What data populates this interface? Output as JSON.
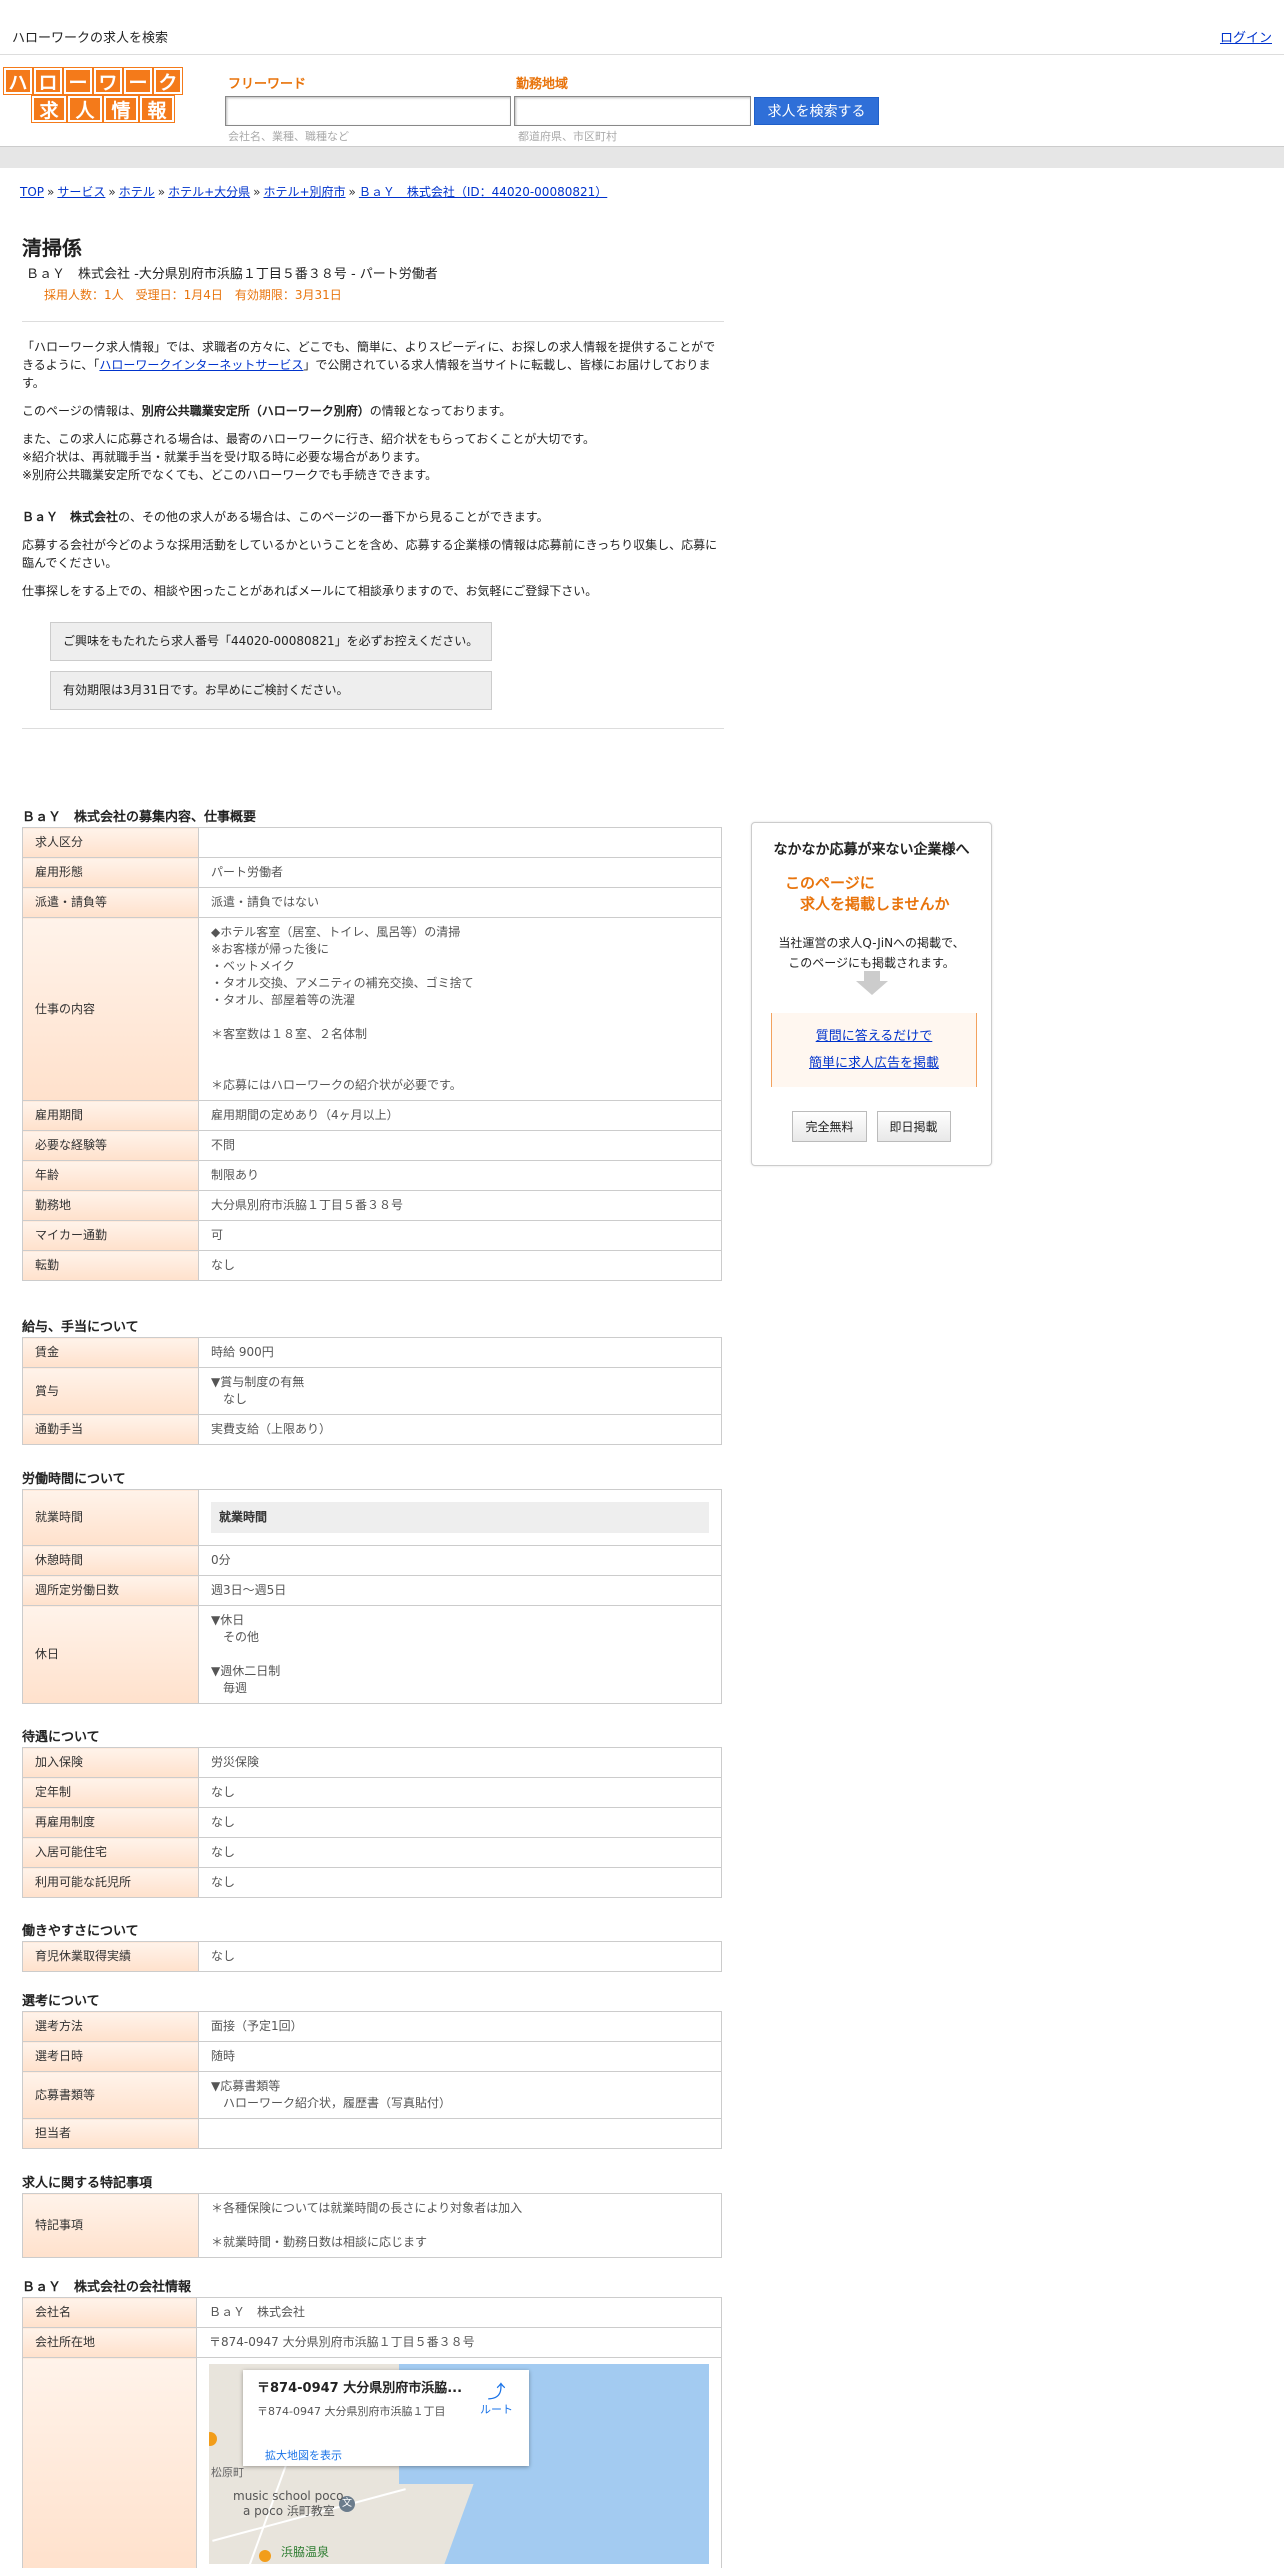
{
  "topbar": {
    "site_title": "ハローワークの求人を検索",
    "login": "ログイン"
  },
  "header": {
    "logo_row1": [
      "ハ",
      "ロ",
      "ー",
      "ワ",
      "ー",
      "ク"
    ],
    "logo_row2": [
      "求",
      "人",
      "情",
      "報"
    ],
    "freeword_label": "フリーワード",
    "freeword_hint": "会社名、業種、職種など",
    "area_label": "勤務地域",
    "area_hint": "都道府県、市区町村",
    "search_button": "求人を検索する"
  },
  "breadcrumb": [
    "TOP",
    "サービス",
    "ホテル",
    "ホテル+大分県",
    "ホテル+別府市",
    "ＢａＹ　株式会社（ID：44020-00080821）"
  ],
  "job": {
    "title": "清掃係",
    "subtitle": "ＢａＹ　株式会社 -大分県別府市浜脇１丁目５番３８号 - パート労働者",
    "meta": "採用人数：1人　受理日：1月4日　有効期限：3月31日"
  },
  "intro": {
    "p1a": "「ハローワーク求人情報」では、求職者の方々に、どこでも、簡単に、よりスピーディに、お探しの求人情報を提供することができるように、「",
    "p1link": "ハローワークインターネットサービス",
    "p1b": "」で公開されている求人情報を当サイトに転載し、皆様にお届けしております。",
    "p2a": "このページの情報は、",
    "p2b": "別府公共職業安定所（ハローワーク別府）",
    "p2c": "の情報となっております。",
    "p3": "また、この求人に応募される場合は、最寄のハローワークに行き、紹介状をもらっておくことが大切です。",
    "p3b": "※紹介状は、再就職手当・就業手当を受け取る時に必要な場合があります。",
    "p3c": "※別府公共職業安定所でなくても、どこのハローワークでも手続きできます。",
    "p4a": "ＢａＹ　株式会社",
    "p4b": "の、その他の求人がある場合は、このページの一番下から見ることができます。",
    "p5": "応募する会社が今どのような採用活動をしているかということを含め、応募する企業様の情報は応募前にきっちり収集し、応募に臨んでください。",
    "p6": "仕事探しをする上での、相談や困ったことがあればメールにて相談承りますので、お気軽にご登録下さい。",
    "notice1": "ご興味をもたれたら求人番号「44020-00080821」を必ずお控えください。",
    "notice2": "有効期限は3月31日です。お早めにご検討ください。"
  },
  "sec_overview": {
    "title": "ＢａＹ　株式会社の募集内容、仕事概要",
    "rows": [
      {
        "k": "求人区分",
        "v": ""
      },
      {
        "k": "雇用形態",
        "v": "パート労働者"
      },
      {
        "k": "派遣・請負等",
        "v": "派遣・請負ではない"
      },
      {
        "k": "仕事の内容",
        "v": "◆ホテル客室（居室、トイレ、風呂等）の清掃\n※お客様が帰った後に\n・ベットメイク\n・タオル交換、アメニティの補充交換、ゴミ捨て\n・タオル、部屋着等の洗濯\n\n＊客室数は１８室、２名体制\n\n\n＊応募にはハローワークの紹介状が必要です。"
      },
      {
        "k": "雇用期間",
        "v": "雇用期間の定めあり（4ヶ月以上）"
      },
      {
        "k": "必要な経験等",
        "v": "不問"
      },
      {
        "k": "年齢",
        "v": "制限あり"
      },
      {
        "k": "勤務地",
        "v": "大分県別府市浜脇１丁目５番３８号"
      },
      {
        "k": "マイカー通勤",
        "v": "可"
      },
      {
        "k": "転勤",
        "v": "なし"
      }
    ]
  },
  "sec_pay": {
    "title": "給与、手当について",
    "rows": [
      {
        "k": "賃金",
        "v": "時給 900円"
      },
      {
        "k": "賞与",
        "v": "▼賞与制度の有無\n　なし"
      },
      {
        "k": "通勤手当",
        "v": "実費支給（上限あり）"
      }
    ]
  },
  "sec_time": {
    "title": "労働時間について",
    "work_hours_key": "就業時間",
    "work_hours_head": "就業時間",
    "rows": [
      {
        "k": "休憩時間",
        "v": "0分"
      },
      {
        "k": "週所定労働日数",
        "v": "週3日〜週5日"
      },
      {
        "k": "休日",
        "v": "▼休日\n　その他\n\n▼週休二日制\n　毎週"
      }
    ]
  },
  "sec_benefit": {
    "title": "待遇について",
    "rows": [
      {
        "k": "加入保険",
        "v": "労災保険"
      },
      {
        "k": "定年制",
        "v": "なし"
      },
      {
        "k": "再雇用制度",
        "v": "なし"
      },
      {
        "k": "入居可能住宅",
        "v": "なし"
      },
      {
        "k": "利用可能な託児所",
        "v": "なし"
      }
    ]
  },
  "sec_ease": {
    "title": "働きやすさについて",
    "rows": [
      {
        "k": "育児休業取得実績",
        "v": "なし"
      }
    ]
  },
  "sec_select": {
    "title": "選考について",
    "rows": [
      {
        "k": "選考方法",
        "v": "面接（予定1回）"
      },
      {
        "k": "選考日時",
        "v": "随時"
      },
      {
        "k": "応募書類等",
        "v": "▼応募書類等\n　ハローワーク紹介状，履歴書（写真貼付）"
      },
      {
        "k": "担当者",
        "v": ""
      }
    ]
  },
  "sec_special": {
    "title": "求人に関する特記事項",
    "rows": [
      {
        "k": "特記事項",
        "v": "＊各種保険については就業時間の長さにより対象者は加入\n\n＊就業時間・勤務日数は相談に応じます"
      }
    ]
  },
  "sec_company": {
    "title": "ＢａＹ　株式会社の会社情報",
    "rows": [
      {
        "k": "会社名",
        "v": "ＢａＹ　株式会社"
      },
      {
        "k": "会社所在地",
        "v": "〒874-0947 大分県別府市浜脇１丁目５番３８号"
      }
    ],
    "map": {
      "card_title": "〒874-0947 大分県別府市浜脇...",
      "card_addr": "〒874-0947 大分県別府市浜脇１丁目",
      "route": "ルート",
      "enlarge": "拡大地図を表示",
      "poi1": "music school poco",
      "poi2": "a poco 浜町教室",
      "poi3": "浜脇温泉",
      "poi4": "松原町"
    }
  },
  "sidebar": {
    "title": "なかなか応募が来ない企業様へ",
    "lead1": "このページに",
    "lead2": "求人を掲載しませんか",
    "desc1": "当社運営の求人Q-JiNへの掲載で、",
    "desc2": "このページにも掲載されます。",
    "link1": "質問に答えるだけで",
    "link2": "簡単に求人広告を掲載",
    "btn1": "完全無料",
    "btn2": "即日掲載"
  }
}
